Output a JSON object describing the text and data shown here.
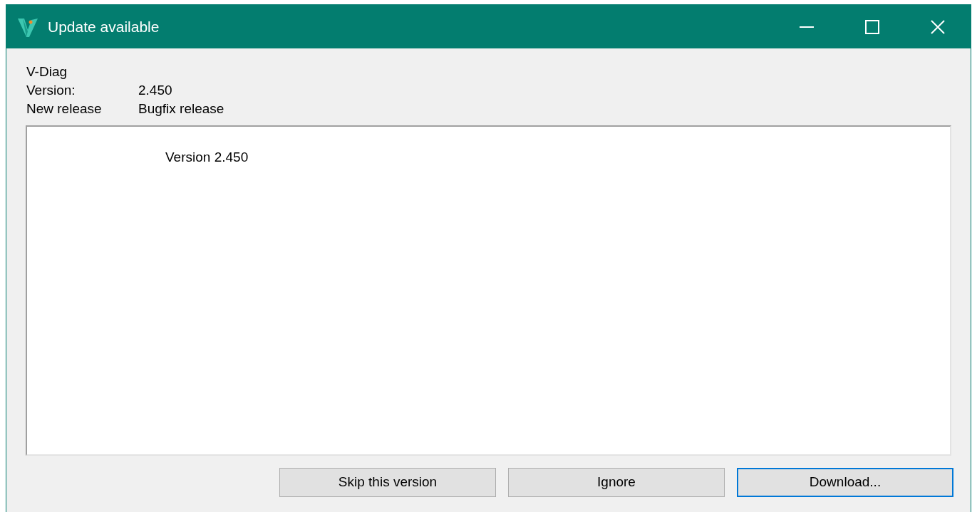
{
  "window": {
    "title": "Update available"
  },
  "info": {
    "product": "V-Diag",
    "rows": [
      {
        "label": "Version:",
        "value": "2.450"
      },
      {
        "label": "New release",
        "value": "Bugfix release"
      }
    ]
  },
  "notes": {
    "text": "Version 2.450"
  },
  "buttons": [
    {
      "label": "Skip this version",
      "focused": false
    },
    {
      "label": "Ignore",
      "focused": false
    },
    {
      "label": "Download...",
      "focused": true
    }
  ]
}
